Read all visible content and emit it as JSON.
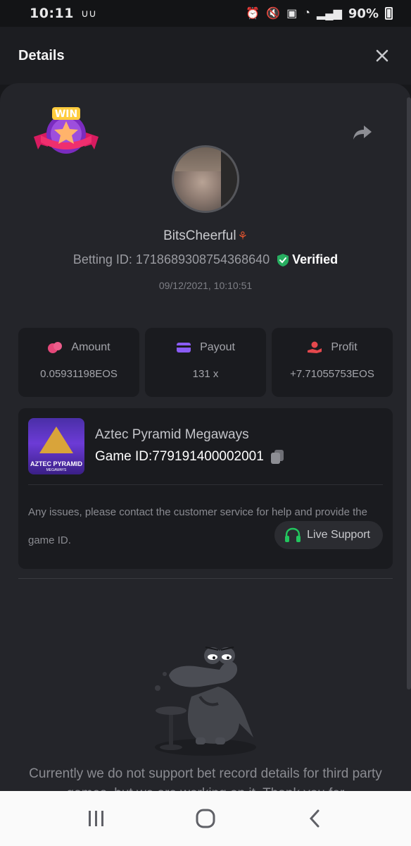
{
  "status_bar": {
    "time": "10:11",
    "battery": "90%"
  },
  "header": {
    "title": "Details"
  },
  "bet": {
    "username": "BitsCheerful",
    "betting_id": "Betting ID: 1718689308754368640",
    "verified_label": "Verified",
    "datetime": "09/12/2021, 10:10:51",
    "badge_text": "WIN"
  },
  "stats": [
    {
      "label": "Amount",
      "value": "0.05931198EOS",
      "icon": "coins-icon",
      "color": "#e5487a"
    },
    {
      "label": "Payout",
      "value": "131 x",
      "icon": "card-icon",
      "color": "#8a5cf6"
    },
    {
      "label": "Profit",
      "value": "+7.71055753EOS",
      "icon": "hand-coin-icon",
      "color": "#e5484d"
    }
  ],
  "game": {
    "name": "Aztec Pyramid Megaways",
    "game_id": "Game ID:779191400002001",
    "thumb_title": "AZTEC PYRAMID",
    "thumb_sub": "MEGAWAYS",
    "support_text": "Any issues, please contact the customer service for help and provide the game ID.",
    "live_support_label": "Live Support"
  },
  "notice": "Currently we do not support bet record details for third party games, but we are working on it. Thank you for",
  "colors": {
    "verified_green": "#27ae60",
    "support_green": "#22c55e"
  }
}
